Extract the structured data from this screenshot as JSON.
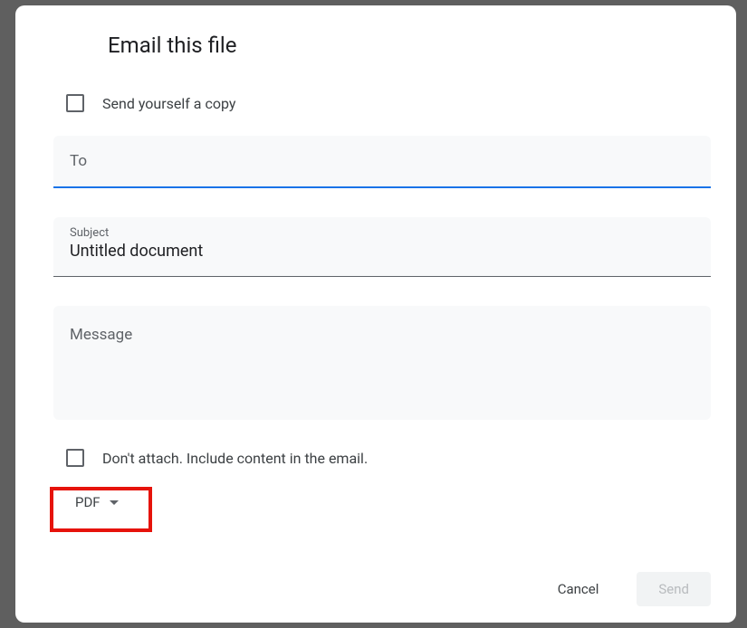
{
  "dialog": {
    "title": "Email this file",
    "send_self_copy_label": "Send yourself a copy",
    "to_placeholder": "To",
    "subject_label": "Subject",
    "subject_value": "Untitled document",
    "message_placeholder": "Message",
    "dont_attach_label": "Don't attach. Include content in the email.",
    "format_selected": "PDF",
    "cancel_label": "Cancel",
    "send_label": "Send"
  }
}
